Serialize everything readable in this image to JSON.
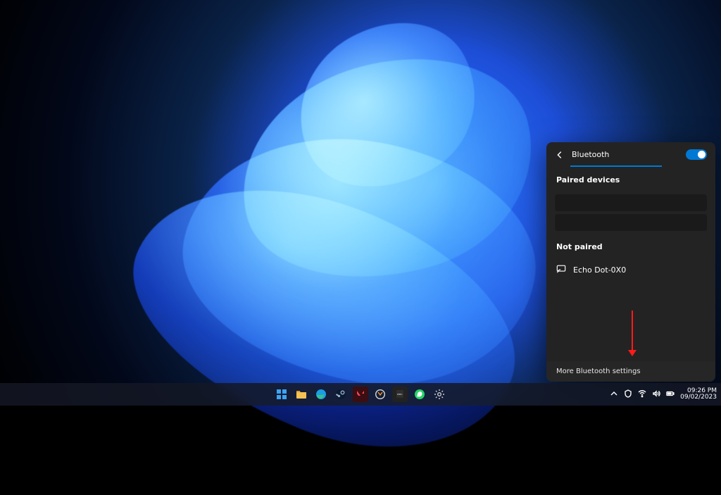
{
  "panel": {
    "title": "Bluetooth",
    "paired_heading": "Paired devices",
    "not_paired_heading": "Not paired",
    "device_name": "Echo Dot-0X0",
    "more_link": "More Bluetooth settings"
  },
  "taskbar": {
    "time": "09:26 PM",
    "date": "09/02/2023"
  }
}
